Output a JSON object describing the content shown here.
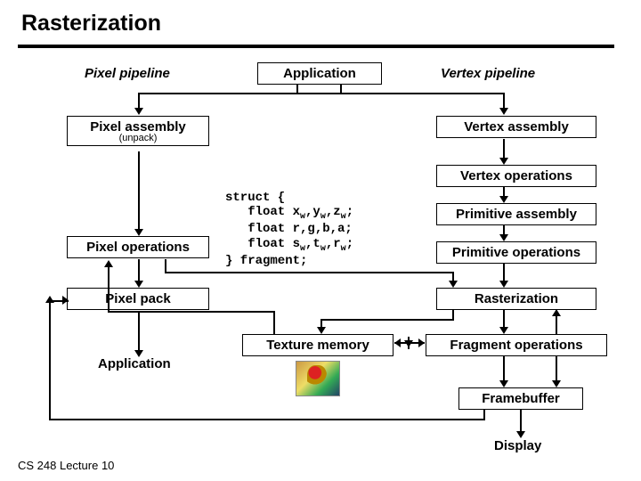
{
  "title": "Rasterization",
  "labels": {
    "pixel_pipeline": "Pixel pipeline",
    "vertex_pipeline": "Vertex pipeline",
    "application_top": "Application",
    "pixel_assembly": "Pixel assembly",
    "pixel_assembly_sub": "(unpack)",
    "vertex_assembly": "Vertex assembly",
    "vertex_operations": "Vertex operations",
    "primitive_assembly": "Primitive assembly",
    "pixel_operations": "Pixel operations",
    "primitive_operations": "Primitive operations",
    "pixel_pack": "Pixel pack",
    "rasterization": "Rasterization",
    "texture_memory": "Texture memory",
    "fragment_operations": "Fragment operations",
    "application_bottom": "Application",
    "framebuffer": "Framebuffer",
    "display": "Display"
  },
  "code": {
    "l1": "struct {",
    "l2a": "   float x",
    "l2b": ",y",
    "l2c": ",z",
    "l2d": ";",
    "l3": "   float r,g,b,a;",
    "l4a": "   float s",
    "l4b": ",t",
    "l4c": ",r",
    "l4d": ";",
    "l5": "} fragment;",
    "sub": "w"
  },
  "footer": "CS 248 Lecture 10"
}
